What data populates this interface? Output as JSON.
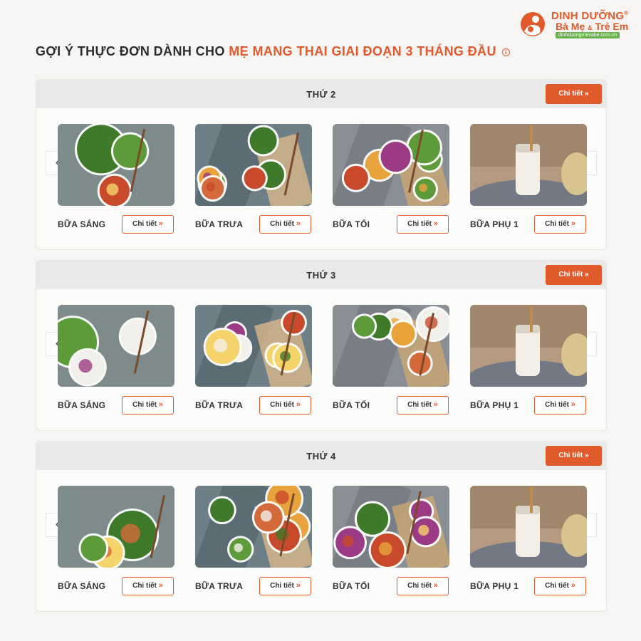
{
  "brand": {
    "line1": "DINH DƯỠNG",
    "registered": "®",
    "line2_a": "Bà Mẹ",
    "line2_amp": "&",
    "line2_b": "Trẻ Em",
    "url": "dinhduongmevabe.com.vn",
    "accent": "#e05a2b",
    "green": "#6ab04c"
  },
  "heading": {
    "part1": "GỢI Ý THỰC ĐƠN DÀNH CHO",
    "part2": "MẸ MANG THAI GIAI ĐOẠN 3 THÁNG ĐẦU",
    "info_icon": "i"
  },
  "days": [
    {
      "title": "THỨ 2",
      "detail_label": "Chi tiết",
      "meals": [
        {
          "label": "BỮA SÁNG",
          "button": "Chi tiết"
        },
        {
          "label": "BỮA TRƯA",
          "button": "Chi tiết"
        },
        {
          "label": "BỮA TỐI",
          "button": "Chi tiết"
        },
        {
          "label": "BỮA PHỤ 1",
          "button": "Chi tiết"
        }
      ]
    },
    {
      "title": "THỨ 3",
      "detail_label": "Chi tiết",
      "meals": [
        {
          "label": "BỮA SÁNG",
          "button": "Chi tiết"
        },
        {
          "label": "BỮA TRƯA",
          "button": "Chi tiết"
        },
        {
          "label": "BỮA TỐI",
          "button": "Chi tiết"
        },
        {
          "label": "BỮA PHỤ 1",
          "button": "Chi tiết"
        }
      ]
    },
    {
      "title": "THỨ 4",
      "detail_label": "Chi tiết",
      "meals": [
        {
          "label": "BỮA SÁNG",
          "button": "Chi tiết"
        },
        {
          "label": "BỮA TRƯA",
          "button": "Chi tiết"
        },
        {
          "label": "BỮA TỐI",
          "button": "Chi tiết"
        },
        {
          "label": "BỮA PHỤ 1",
          "button": "Chi tiết"
        }
      ]
    }
  ],
  "icons": {
    "chevron_double": "»",
    "arrow_left": "‹",
    "arrow_right": "›"
  }
}
